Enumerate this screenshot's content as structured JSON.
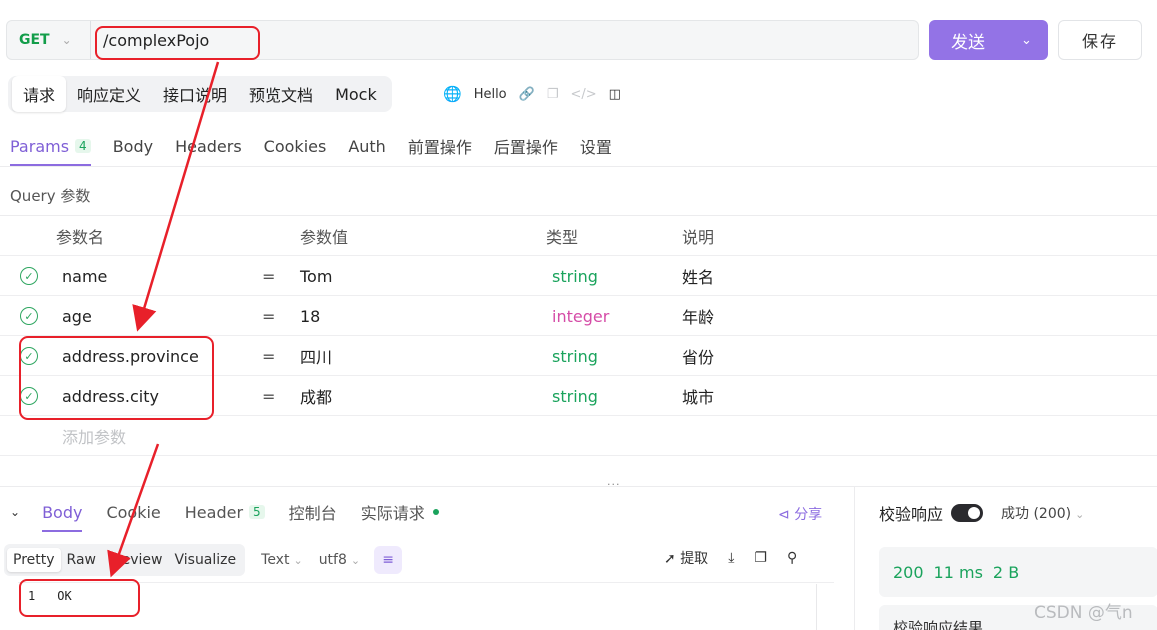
{
  "request": {
    "method": "GET",
    "url": "/complexPojo",
    "send_label": "发送",
    "save_label": "保存"
  },
  "doc_tabs": [
    "请求",
    "响应定义",
    "接口说明",
    "预览文档",
    "Mock"
  ],
  "env_name": "Hello",
  "params_tabs": {
    "params_label": "Params",
    "params_count": "4",
    "items": [
      "Body",
      "Headers",
      "Cookies",
      "Auth",
      "前置操作",
      "后置操作",
      "设置"
    ]
  },
  "query": {
    "title": "Query 参数",
    "headers": {
      "name": "参数名",
      "value": "参数值",
      "type": "类型",
      "desc": "说明"
    },
    "rows": [
      {
        "name": "name",
        "eq": "=",
        "value": "Tom",
        "type": "string",
        "desc": "姓名"
      },
      {
        "name": "age",
        "eq": "=",
        "value": "18",
        "type": "integer",
        "desc": "年龄"
      },
      {
        "name": "address.province",
        "eq": "=",
        "value": "四川",
        "type": "string",
        "desc": "省份"
      },
      {
        "name": "address.city",
        "eq": "=",
        "value": "成都",
        "type": "string",
        "desc": "城市"
      }
    ],
    "add_label": "添加参数"
  },
  "response": {
    "tabs": {
      "body": "Body",
      "cookie": "Cookie",
      "header": "Header",
      "header_count": "5",
      "console": "控制台",
      "actual": "实际请求"
    },
    "share": "分享",
    "formats": [
      "Pretty",
      "Raw",
      "Preview",
      "Visualize"
    ],
    "type_select": "Text",
    "encoding_select": "utf8",
    "extract": "提取",
    "code": {
      "line_no": "1",
      "text": "OK"
    }
  },
  "validation": {
    "label": "校验响应",
    "status": "成功 (200)",
    "status_code": "200",
    "time": "11 ms",
    "size": "2 B",
    "result_label": "校验响应结果"
  },
  "watermark": "CSDN @气n",
  "colors": {
    "accent": "#9373e6",
    "success": "#1aa35c",
    "integer": "#d54ca7",
    "annotation": "#e8202a"
  }
}
